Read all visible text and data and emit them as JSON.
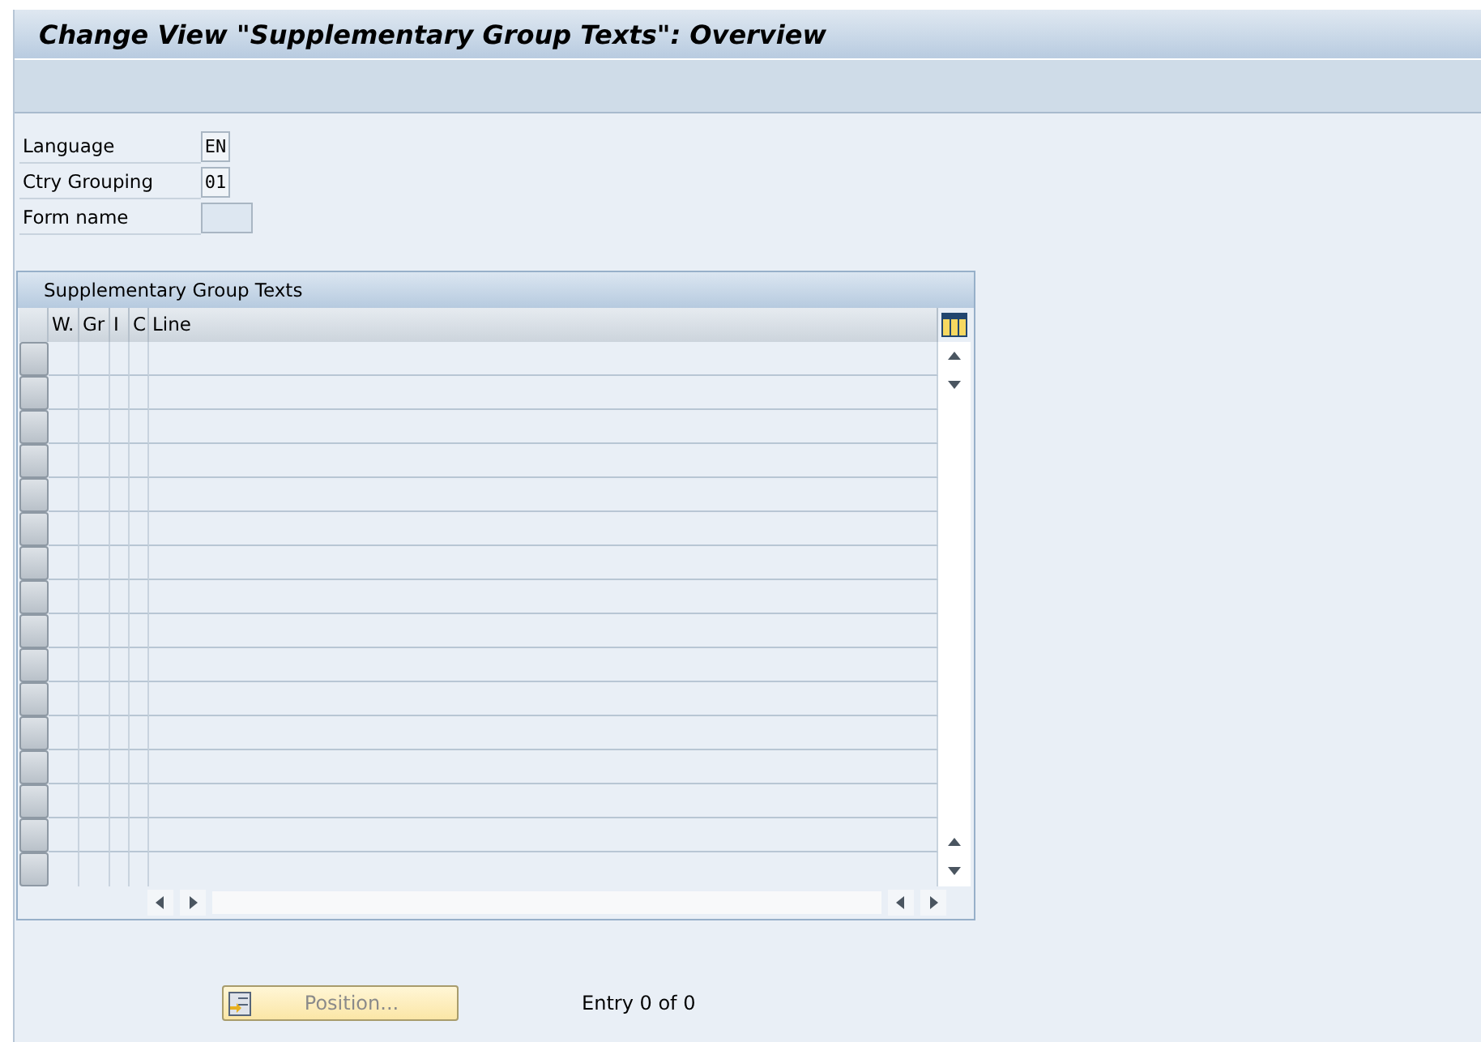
{
  "window": {
    "title": "Change View \"Supplementary Group Texts\": Overview"
  },
  "fields": [
    {
      "label": "Language",
      "value": "EN",
      "kind": "short"
    },
    {
      "label": "Ctry Grouping",
      "value": "01",
      "kind": "short"
    },
    {
      "label": "Form name",
      "kind": "wide"
    }
  ],
  "table": {
    "title": "Supplementary Group Texts",
    "columns": [
      "W.",
      "Gr",
      "I",
      "C",
      "Line"
    ]
  },
  "position_button": {
    "label": "Position...",
    "disabled": true
  },
  "entry_count": "Entry 0 of 0"
}
